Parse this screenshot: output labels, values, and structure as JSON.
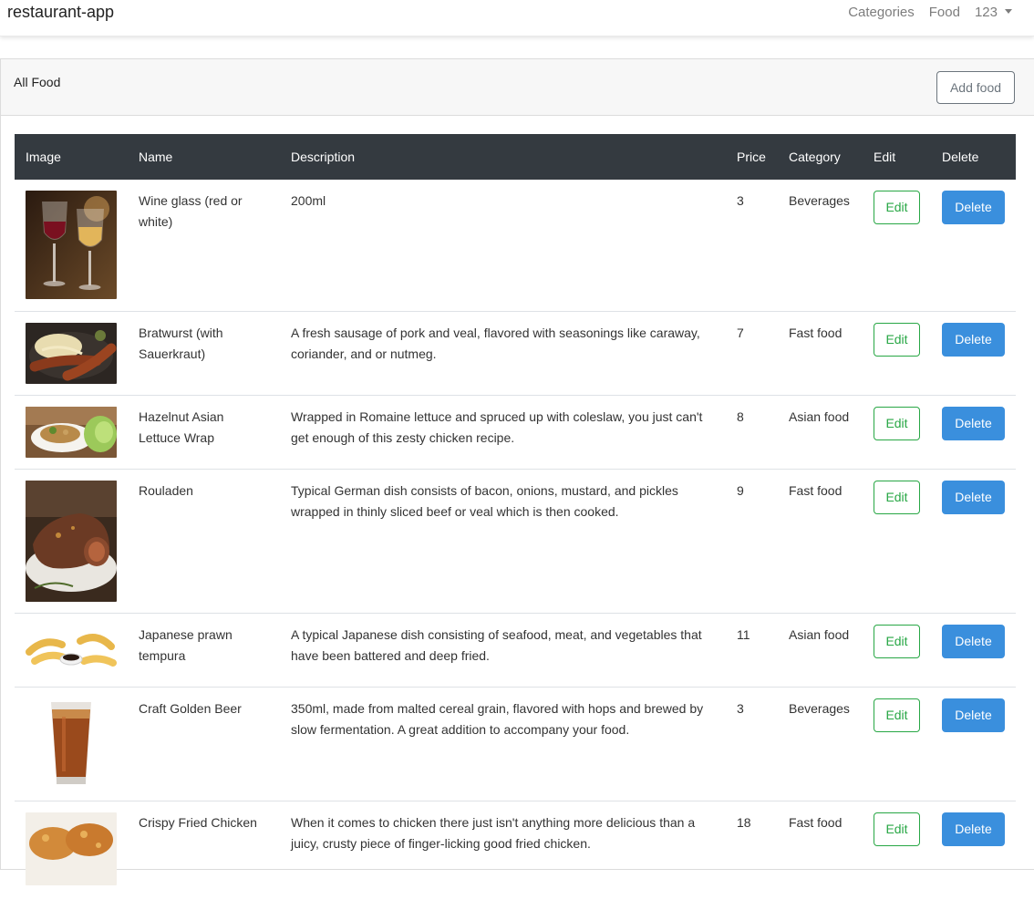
{
  "navbar": {
    "brand": "restaurant-app",
    "links": {
      "categories": "Categories",
      "food": "Food",
      "user": "123"
    }
  },
  "card": {
    "title": "All Food",
    "add_button": "Add food"
  },
  "table": {
    "headers": [
      "Image",
      "Name",
      "Description",
      "Price",
      "Category",
      "Edit",
      "Delete"
    ],
    "rows": [
      {
        "name": "Wine glass (red or white)",
        "description": "200ml",
        "price": "3",
        "category": "Beverages",
        "edit": "Edit",
        "delete": "Delete",
        "image": "wine-glasses-photo"
      },
      {
        "name": "Bratwurst (with Sauerkraut)",
        "description": "A fresh sausage of pork and veal, flavored with seasonings like caraway, coriander, and or nutmeg.",
        "price": "7",
        "category": "Fast food",
        "edit": "Edit",
        "delete": "Delete",
        "image": "bratwurst-photo"
      },
      {
        "name": "Hazelnut Asian Lettuce Wrap",
        "description": "Wrapped in Romaine lettuce and spruced up with coleslaw, you just can't get enough of this zesty chicken recipe.",
        "price": "8",
        "category": "Asian food",
        "edit": "Edit",
        "delete": "Delete",
        "image": "lettuce-wrap-photo"
      },
      {
        "name": "Rouladen",
        "description": "Typical German dish consists of bacon, onions, mustard, and pickles wrapped in thinly sliced beef or veal which is then cooked.",
        "price": "9",
        "category": "Fast food",
        "edit": "Edit",
        "delete": "Delete",
        "image": "rouladen-photo"
      },
      {
        "name": "Japanese prawn tempura",
        "description": "A typical Japanese dish consisting of seafood, meat, and vegetables that have been battered and deep fried.",
        "price": "11",
        "category": "Asian food",
        "edit": "Edit",
        "delete": "Delete",
        "image": "tempura-photo"
      },
      {
        "name": "Craft Golden Beer",
        "description": "350ml, made from malted cereal grain, flavored with hops and brewed by slow fermentation. A great addition to accompany your food.",
        "price": "3",
        "category": "Beverages",
        "edit": "Edit",
        "delete": "Delete",
        "image": "beer-glass-photo"
      },
      {
        "name": "Crispy Fried Chicken",
        "description": "When it comes to chicken there just isn't anything more delicious than a juicy, crusty piece of finger-licking good fried chicken.",
        "price": "18",
        "category": "Fast food",
        "edit": "Edit",
        "delete": "Delete",
        "image": "fried-chicken-photo"
      }
    ]
  },
  "colors": {
    "header_bg": "#343a40",
    "edit_green": "#28a745",
    "delete_blue": "#3a8fdd"
  }
}
